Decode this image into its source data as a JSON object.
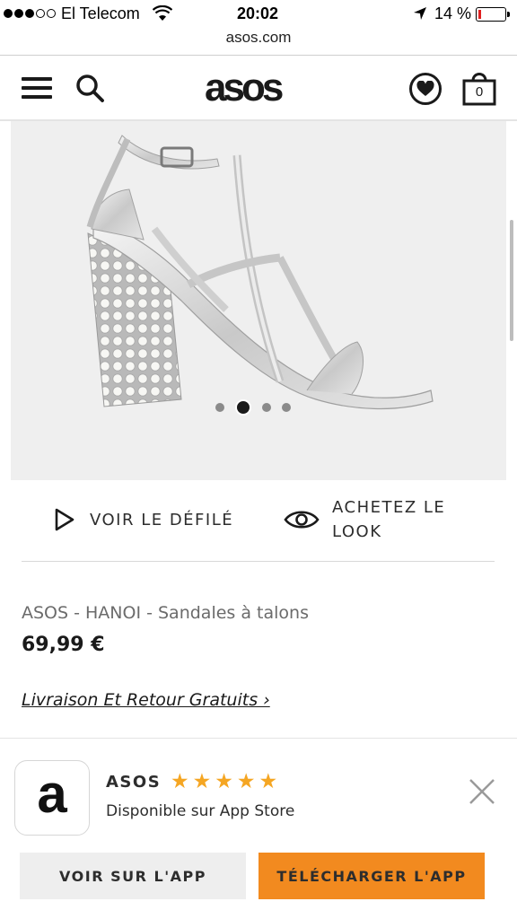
{
  "status_bar": {
    "carrier": "El Telecom",
    "time": "20:02",
    "battery": "14 %"
  },
  "browser": {
    "url": "asos.com"
  },
  "header": {
    "logo": "asos",
    "bag_count": "0"
  },
  "product": {
    "carousel_total": 4,
    "carousel_active": 2,
    "actions": {
      "catwalk_label": "VOIR LE DÉFILÉ",
      "shop_look_label": "ACHETEZ LE LOOK"
    },
    "name": "ASOS - HANOI - Sandales à talons",
    "price": "69,99 €",
    "delivery_link": "Livraison Et Retour Gratuits ›"
  },
  "app_banner": {
    "icon_letter": "a",
    "name": "ASOS",
    "rating_stars": 5,
    "subtitle": "Disponible sur App Store",
    "view_button": "VOIR SUR L'APP",
    "download_button": "TÉLÉCHARGER L'APP"
  },
  "colors": {
    "accent_orange": "#f28a1f",
    "star_color": "#f5a623",
    "battery_low": "#e02020"
  }
}
